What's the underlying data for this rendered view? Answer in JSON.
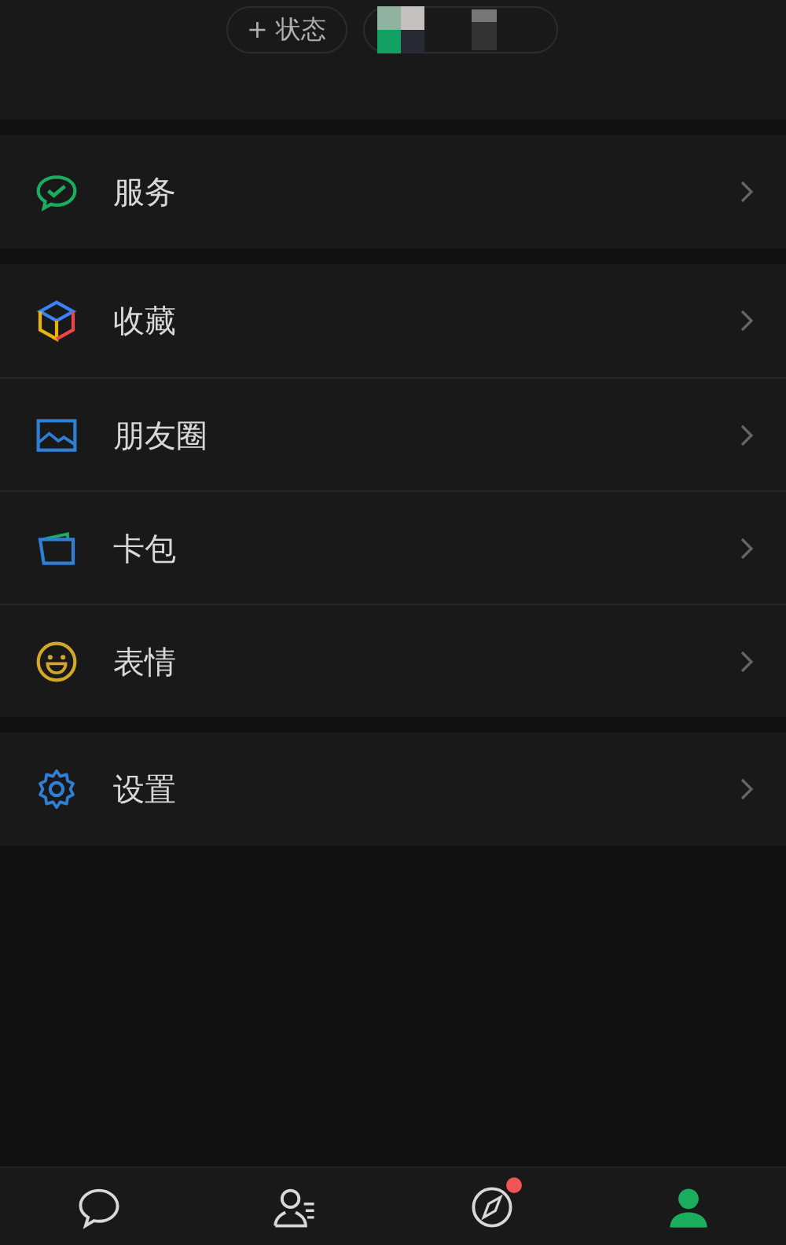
{
  "header": {
    "status_button": "+ 状态"
  },
  "groups": [
    {
      "items": [
        {
          "kind": "pay",
          "label": "服务"
        }
      ]
    },
    {
      "items": [
        {
          "kind": "favorites",
          "label": "收藏"
        },
        {
          "kind": "moments",
          "label": "朋友圈"
        },
        {
          "kind": "cards",
          "label": "卡包"
        },
        {
          "kind": "stickers",
          "label": "表情"
        }
      ]
    },
    {
      "items": [
        {
          "kind": "settings",
          "label": "设置"
        }
      ]
    }
  ],
  "tab_bar": [
    {
      "kind": "chats",
      "selected": false,
      "dot": false
    },
    {
      "kind": "contacts",
      "selected": false,
      "dot": false
    },
    {
      "kind": "discover",
      "selected": false,
      "dot": true
    },
    {
      "kind": "me",
      "selected": true,
      "dot": false
    }
  ]
}
